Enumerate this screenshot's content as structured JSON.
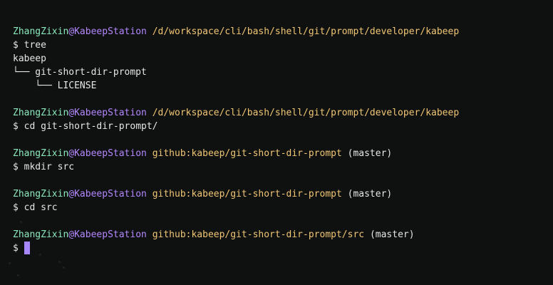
{
  "terminal": {
    "blocks": [
      {
        "user": "ZhangZixin",
        "at": "@",
        "host": "KabeepStation",
        "path": "/d/workspace/cli/bash/shell/git/prompt/developer/kabeep",
        "branch": "",
        "command": "tree",
        "output": [
          "kabeep",
          "└── git-short-dir-prompt",
          "    └── LICENSE"
        ]
      },
      {
        "user": "ZhangZixin",
        "at": "@",
        "host": "KabeepStation",
        "path": "/d/workspace/cli/bash/shell/git/prompt/developer/kabeep",
        "branch": "",
        "command": "cd git-short-dir-prompt/",
        "output": []
      },
      {
        "user": "ZhangZixin",
        "at": "@",
        "host": "KabeepStation",
        "path": "github:kabeep/git-short-dir-prompt",
        "branch": "(master)",
        "command": "mkdir src",
        "output": []
      },
      {
        "user": "ZhangZixin",
        "at": "@",
        "host": "KabeepStation",
        "path": "github:kabeep/git-short-dir-prompt",
        "branch": "(master)",
        "command": "cd src",
        "output": []
      },
      {
        "user": "ZhangZixin",
        "at": "@",
        "host": "KabeepStation",
        "path": "github:kabeep/git-short-dir-prompt/src",
        "branch": "(master)",
        "command": "",
        "output": []
      }
    ],
    "prompt_symbol": "$",
    "colors": {
      "background": "#0f1010",
      "user": "#8be9bd",
      "host": "#b488ff",
      "path": "#f0c674",
      "cursor": "#a987ff"
    }
  }
}
